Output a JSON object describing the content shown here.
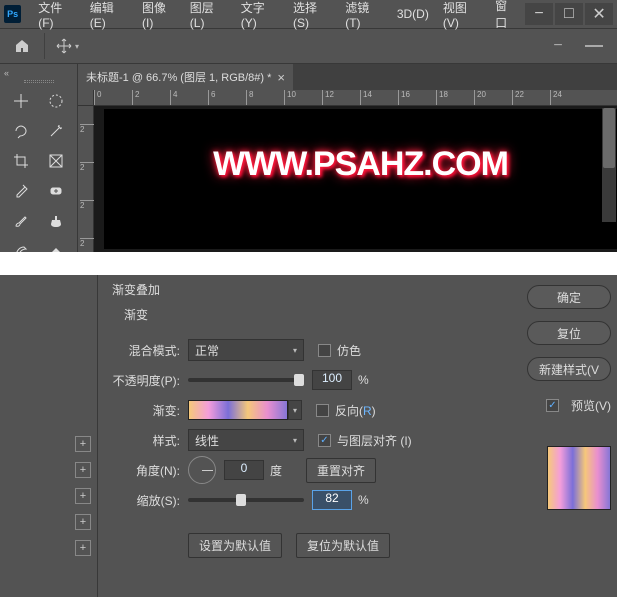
{
  "app": {
    "logo": "Ps"
  },
  "menu": {
    "file": "文件(F)",
    "edit": "编辑(E)",
    "image": "图像(I)",
    "layer": "图层(L)",
    "type": "文字(Y)",
    "select": "选择(S)",
    "filter": "滤镜(T)",
    "3d": "3D(D)",
    "view": "视图(V)",
    "window": "窗口"
  },
  "tab": {
    "title": "未标题-1 @ 66.7% (图层 1, RGB/8#) *"
  },
  "ruler": {
    "h": [
      "0",
      "2",
      "4",
      "6",
      "8",
      "10",
      "12",
      "14",
      "16",
      "18",
      "20",
      "22",
      "24"
    ],
    "v": [
      "2",
      "2",
      "2",
      "2"
    ]
  },
  "canvas": {
    "text": "WWW.PSAHZ.COM"
  },
  "dialog": {
    "title": "渐变叠加",
    "subtitle": "渐变",
    "labels": {
      "blend": "混合模式:",
      "opacity": "不透明度(P):",
      "gradient": "渐变:",
      "style": "样式:",
      "angle": "角度(N):",
      "scale": "缩放(S):"
    },
    "values": {
      "blend": "正常",
      "opacity": "100",
      "style": "线性",
      "angle": "0",
      "angle_unit": "度",
      "scale": "82",
      "pct": "%"
    },
    "checks": {
      "dither": "仿色",
      "reverse_pre": "反向(",
      "reverse_hot": "R",
      "reverse_post": ")",
      "align": "与图层对齐 (I)"
    },
    "buttons": {
      "reset_align": "重置对齐",
      "set_default": "设置为默认值",
      "reset_default": "复位为默认值",
      "ok": "确定",
      "cancel": "复位",
      "new_style": "新建样式(V",
      "preview": "预览(V)"
    }
  }
}
